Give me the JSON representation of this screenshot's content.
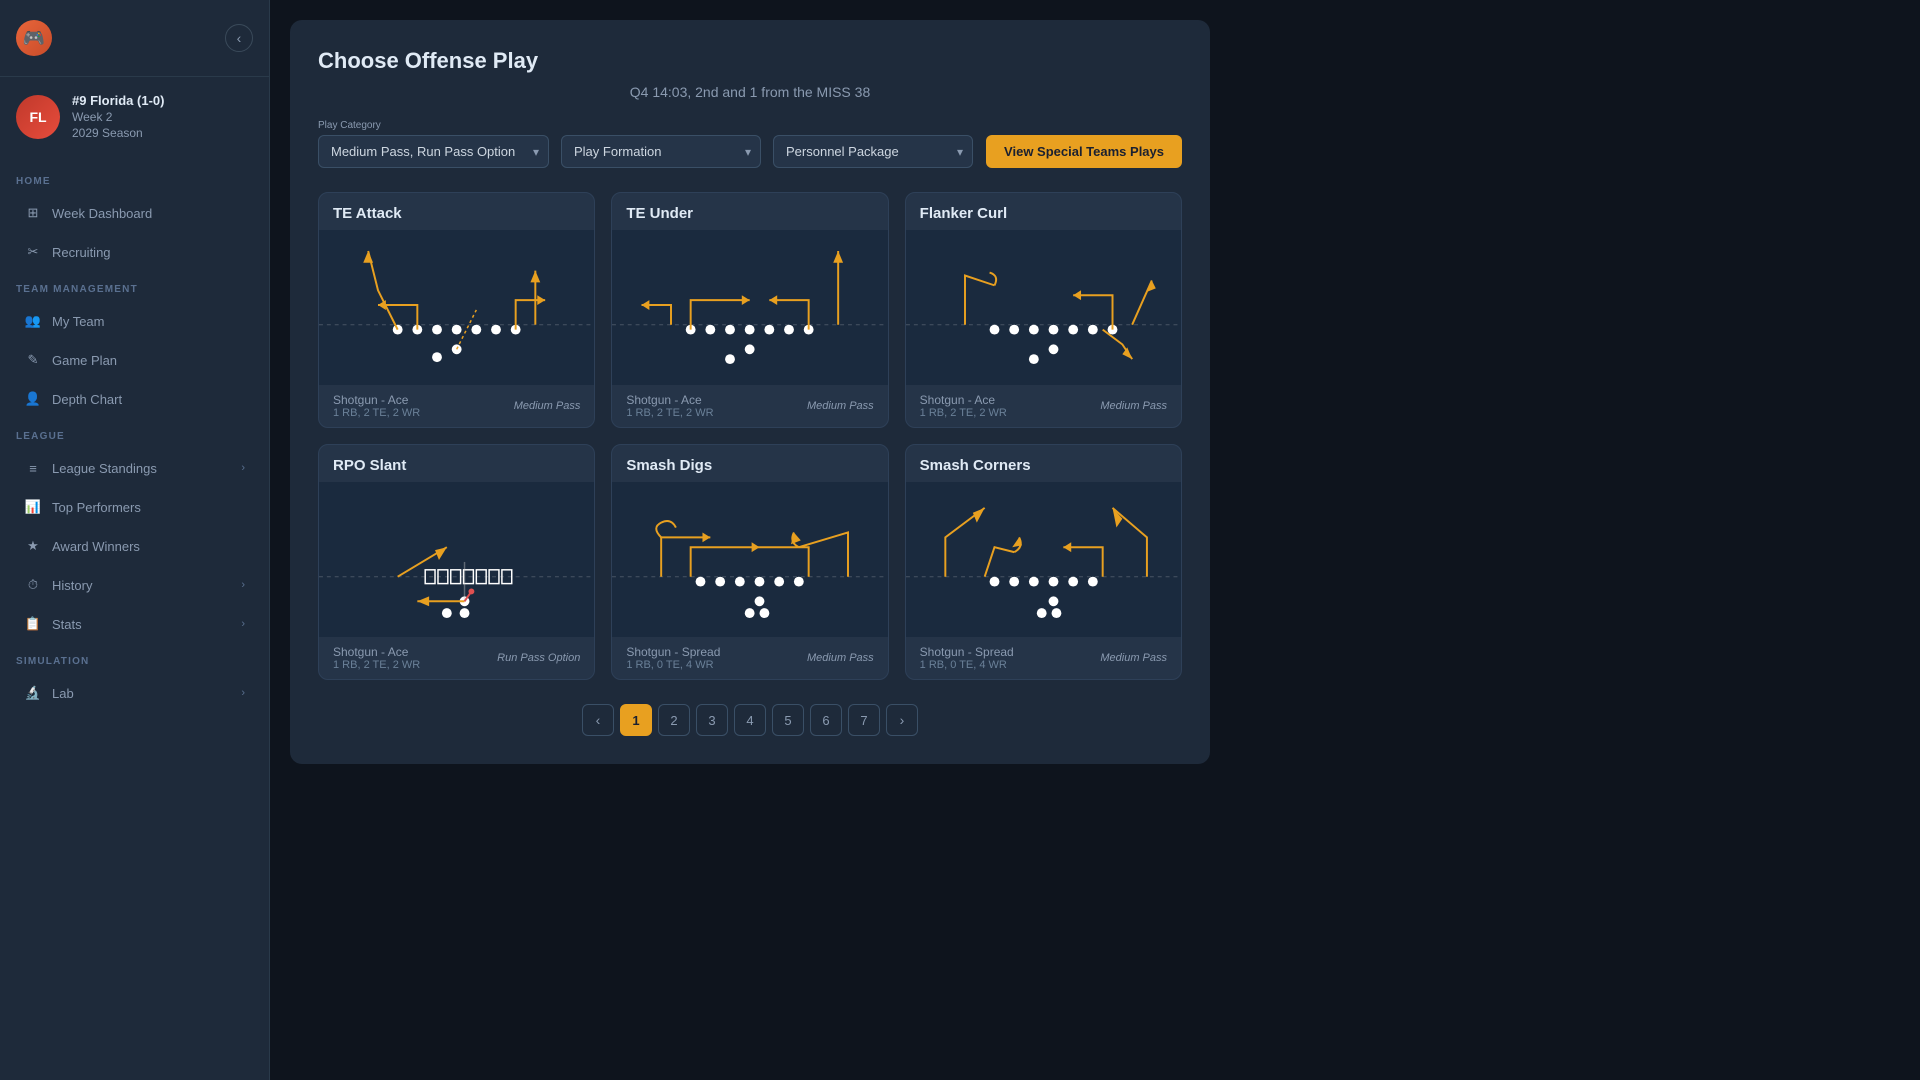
{
  "sidebar": {
    "logo_emoji": "🎮",
    "back_button": "‹",
    "team": {
      "initials": "FL",
      "name": "#9 Florida (1-0)",
      "week": "Week 2",
      "season": "2029 Season"
    },
    "sections": [
      {
        "label": "HOME",
        "items": [
          {
            "id": "week-dashboard",
            "label": "Week Dashboard",
            "icon": "⊞",
            "has_chevron": false
          },
          {
            "id": "recruiting",
            "label": "Recruiting",
            "icon": "✂",
            "has_chevron": false
          }
        ]
      },
      {
        "label": "TEAM MANAGEMENT",
        "items": [
          {
            "id": "my-team",
            "label": "My Team",
            "icon": "👥",
            "has_chevron": false
          },
          {
            "id": "game-plan",
            "label": "Game Plan",
            "icon": "✎",
            "has_chevron": false
          },
          {
            "id": "depth-chart",
            "label": "Depth Chart",
            "icon": "👤",
            "has_chevron": false
          }
        ]
      },
      {
        "label": "LEAGUE",
        "items": [
          {
            "id": "league-standings",
            "label": "League Standings",
            "icon": "≡",
            "has_chevron": true
          },
          {
            "id": "top-performers",
            "label": "Top Performers",
            "icon": "📊",
            "has_chevron": false
          },
          {
            "id": "award-winners",
            "label": "Award Winners",
            "icon": "★",
            "has_chevron": false
          },
          {
            "id": "history",
            "label": "History",
            "icon": "⏱",
            "has_chevron": true
          },
          {
            "id": "stats",
            "label": "Stats",
            "icon": "📋",
            "has_chevron": true
          }
        ]
      },
      {
        "label": "SIMULATION",
        "items": [
          {
            "id": "lab",
            "label": "Lab",
            "icon": "🔬",
            "has_chevron": true
          }
        ]
      }
    ]
  },
  "modal": {
    "title": "Choose Offense Play",
    "subtitle": "Q4 14:03, 2nd and 1 from the MISS 38",
    "filters": {
      "play_category_label": "Play Category",
      "play_category_value": "Medium Pass, Run Pass Option",
      "play_formation_label": "Play Formation",
      "play_formation_placeholder": "Play Formation",
      "personnel_package_label": "",
      "personnel_package_placeholder": "Personnel Package",
      "special_teams_btn": "View Special Teams Plays"
    },
    "plays": [
      {
        "id": "te-attack",
        "title": "TE Attack",
        "formation": "Shotgun - Ace",
        "personnel": "1 RB, 2 TE, 2 WR",
        "type": "Medium Pass",
        "diagram": "shotgun_ace_te_attack"
      },
      {
        "id": "te-under",
        "title": "TE Under",
        "formation": "Shotgun - Ace",
        "personnel": "1 RB, 2 TE, 2 WR",
        "type": "Medium Pass",
        "diagram": "shotgun_ace_te_under"
      },
      {
        "id": "flanker-curl",
        "title": "Flanker Curl",
        "formation": "Shotgun - Ace",
        "personnel": "1 RB, 2 TE, 2 WR",
        "type": "Medium Pass",
        "diagram": "shotgun_ace_flanker_curl"
      },
      {
        "id": "rpo-slant",
        "title": "RPO Slant",
        "formation": "Shotgun - Ace",
        "personnel": "1 RB, 2 TE, 2 WR",
        "type": "Run Pass Option",
        "diagram": "shotgun_ace_rpo_slant"
      },
      {
        "id": "smash-digs",
        "title": "Smash Digs",
        "formation": "Shotgun - Spread",
        "personnel": "1 RB, 0 TE, 4 WR",
        "type": "Medium Pass",
        "diagram": "shotgun_spread_smash_digs"
      },
      {
        "id": "smash-corners",
        "title": "Smash Corners",
        "formation": "Shotgun - Spread",
        "personnel": "1 RB, 0 TE, 4 WR",
        "type": "Medium Pass",
        "diagram": "shotgun_spread_smash_corners"
      }
    ],
    "pagination": {
      "current": 1,
      "total": 7,
      "prev": "‹",
      "next": "›"
    }
  },
  "colors": {
    "accent": "#e8a020",
    "bg_dark": "#1a2332",
    "bg_card": "#253448",
    "text_primary": "#e0eaf5",
    "text_secondary": "#8a9ab0",
    "route_color": "#e8a020",
    "player_dot": "#ffffff",
    "line_scrimmage": "rgba(255,255,255,0.3)"
  }
}
